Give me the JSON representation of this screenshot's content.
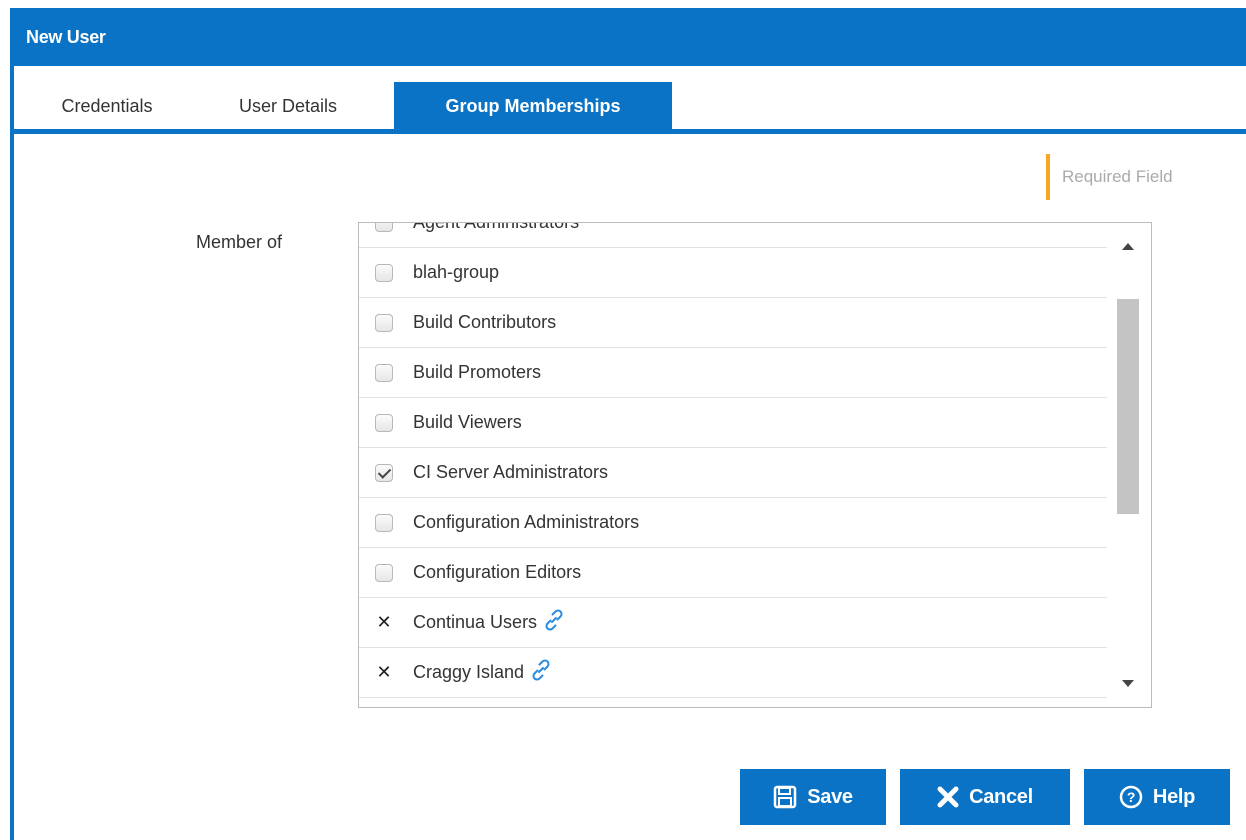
{
  "dialog": {
    "title": "New User"
  },
  "tabs": [
    {
      "label": "Credentials",
      "active": false
    },
    {
      "label": "User Details",
      "active": false
    },
    {
      "label": "Group Memberships",
      "active": true
    }
  ],
  "required_field_label": "Required Field",
  "member_of": {
    "label": "Member of",
    "items": [
      {
        "label": "Agent Administrators",
        "state": "unchecked"
      },
      {
        "label": "blah-group",
        "state": "unchecked"
      },
      {
        "label": "Build Contributors",
        "state": "unchecked"
      },
      {
        "label": "Build Promoters",
        "state": "unchecked"
      },
      {
        "label": "Build Viewers",
        "state": "unchecked"
      },
      {
        "label": "CI Server Administrators",
        "state": "checked"
      },
      {
        "label": "Configuration Administrators",
        "state": "unchecked"
      },
      {
        "label": "Configuration Editors",
        "state": "unchecked"
      },
      {
        "label": "Continua Users",
        "state": "linked",
        "icon": "link-icon"
      },
      {
        "label": "Craggy Island",
        "state": "linked",
        "icon": "link-icon"
      }
    ]
  },
  "buttons": {
    "save": {
      "label": "Save",
      "icon": "save-icon"
    },
    "cancel": {
      "label": "Cancel",
      "icon": "close-icon"
    },
    "help": {
      "label": "Help",
      "icon": "help-icon"
    }
  },
  "colors": {
    "accent": "#0a73c6",
    "required": "#f5a623"
  }
}
